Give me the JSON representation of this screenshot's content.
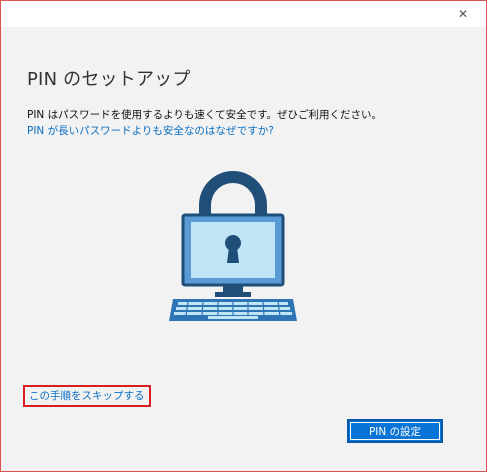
{
  "titlebar": {
    "close_glyph": "✕"
  },
  "dialog": {
    "title": "PIN のセットアップ",
    "description": "PIN はパスワードを使用するよりも速くて安全です。ぜひご利用ください。",
    "help_link": "PIN が長いパスワードよりも安全なのはなぜですか?",
    "skip_link": "この手順をスキップする",
    "primary_button": "PIN の設定"
  },
  "illustration": {
    "icon": "lock-computer-icon",
    "colors": {
      "dark": "#1f4e79",
      "screen": "#bfe5f6",
      "mid": "#2e75b6",
      "keyboard": "#5b9bd5"
    }
  }
}
